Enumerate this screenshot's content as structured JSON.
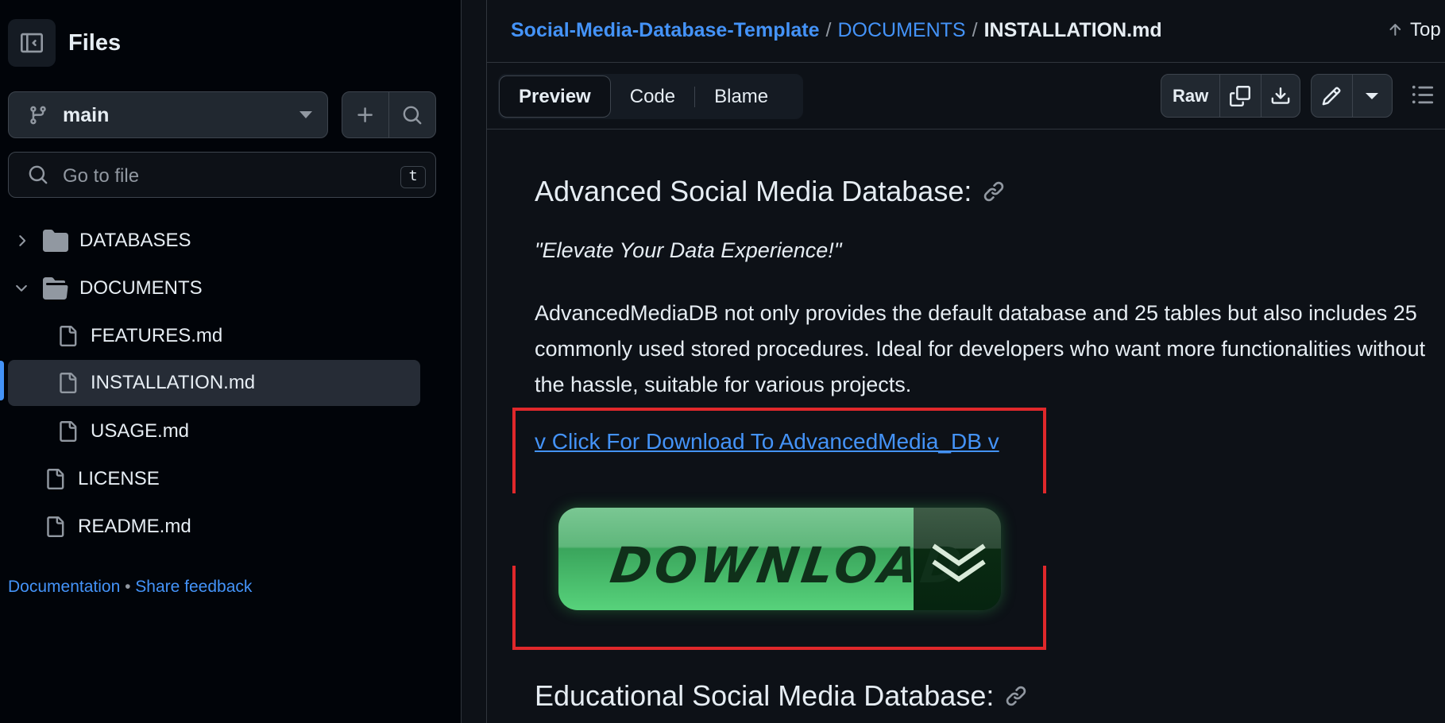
{
  "sidebar": {
    "title": "Files",
    "branch": "main",
    "search_placeholder": "Go to file",
    "search_shortcut": "t",
    "tree": [
      {
        "label": "DATABASES",
        "type": "folder",
        "expanded": false
      },
      {
        "label": "DOCUMENTS",
        "type": "folder",
        "expanded": true
      },
      {
        "label": "FEATURES.md",
        "type": "file"
      },
      {
        "label": "INSTALLATION.md",
        "type": "file",
        "selected": true
      },
      {
        "label": "USAGE.md",
        "type": "file"
      },
      {
        "label": "LICENSE",
        "type": "file"
      },
      {
        "label": "README.md",
        "type": "file"
      }
    ],
    "footer": {
      "documentation": "Documentation",
      "separator": "•",
      "feedback": "Share feedback"
    }
  },
  "header": {
    "repo": "Social-Media-Database-Template",
    "folder": "DOCUMENTS",
    "file": "INSTALLATION.md",
    "separator": "/",
    "top_label": "Top"
  },
  "toolbar": {
    "tabs": [
      "Preview",
      "Code",
      "Blame"
    ],
    "raw_label": "Raw"
  },
  "content": {
    "heading1": "Advanced Social Media Database:",
    "quote": "\"Elevate Your Data Experience!\"",
    "paragraph": "AdvancedMediaDB not only provides the default database and 25 tables but also includes 25 commonly used stored procedures. Ideal for developers who want more functionalities without the hassle, suitable for various projects.",
    "download_link": "v Click For Download To AdvancedMedia_DB v",
    "download_button": "DOWNLOAD",
    "heading2": "Educational Social Media Database:"
  },
  "colors": {
    "accent": "#4493f8",
    "highlight_box": "#e0282b",
    "download_green": "#3aa55c"
  }
}
